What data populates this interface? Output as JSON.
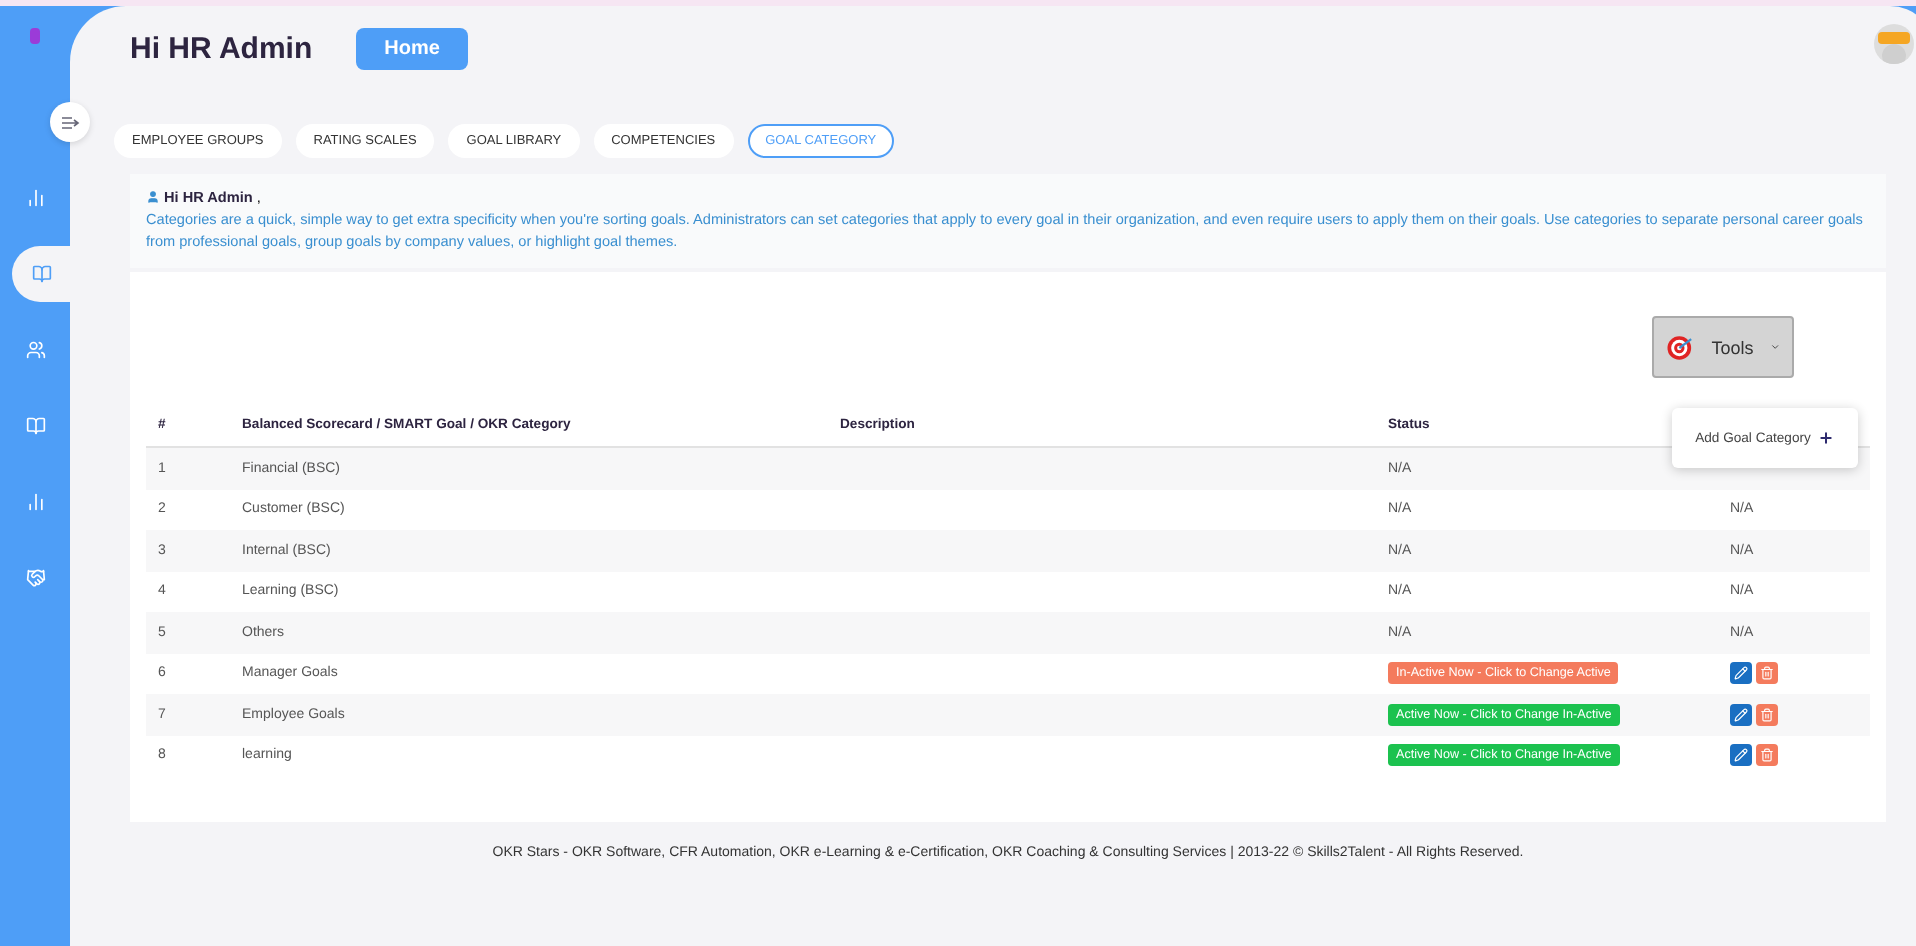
{
  "header": {
    "greeting": "Hi HR Admin",
    "home_button": "Home"
  },
  "sidebar": {
    "items": [
      {
        "selected": false
      },
      {
        "selected": true
      },
      {
        "selected": false
      },
      {
        "selected": false
      },
      {
        "selected": false
      },
      {
        "selected": false
      }
    ]
  },
  "tabs": [
    {
      "label": "EMPLOYEE GROUPS",
      "selected": false
    },
    {
      "label": "RATING SCALES",
      "selected": false
    },
    {
      "label": "GOAL LIBRARY",
      "selected": false
    },
    {
      "label": "COMPETENCIES",
      "selected": false
    },
    {
      "label": "GOAL CATEGORY",
      "selected": true
    }
  ],
  "info": {
    "greeting": "Hi HR Admin",
    "greeting_suffix": ",",
    "text": "Categories are a quick, simple way to get extra specificity when you're sorting goals. Administrators can set categories that apply to every goal in their organization, and even require users to apply them on their goals. Use categories to separate personal career goals from professional goals, group goals by company values, or highlight goal themes."
  },
  "tools": {
    "label": "Tools",
    "menu": [
      {
        "label": "Add Goal Category"
      }
    ]
  },
  "table": {
    "columns": [
      "#",
      "Balanced Scorecard / SMART Goal / OKR Category",
      "Description",
      "Status"
    ],
    "rows": [
      {
        "num": "1",
        "category": "Financial (BSC)",
        "status": {
          "kind": "text",
          "label": "N/A"
        }
      },
      {
        "num": "2",
        "category": "Customer (BSC)",
        "status": {
          "kind": "text",
          "label": "N/A"
        },
        "actions": {
          "kind": "text",
          "label": "N/A"
        }
      },
      {
        "num": "3",
        "category": "Internal (BSC)",
        "status": {
          "kind": "text",
          "label": "N/A"
        },
        "actions": {
          "kind": "text",
          "label": "N/A"
        }
      },
      {
        "num": "4",
        "category": "Learning (BSC)",
        "status": {
          "kind": "text",
          "label": "N/A"
        },
        "actions": {
          "kind": "text",
          "label": "N/A"
        }
      },
      {
        "num": "5",
        "category": "Others",
        "status": {
          "kind": "text",
          "label": "N/A"
        },
        "actions": {
          "kind": "text",
          "label": "N/A"
        }
      },
      {
        "num": "6",
        "category": "Manager Goals",
        "status": {
          "kind": "inactive",
          "label": "In-Active Now - Click to Change Active"
        },
        "actions": {
          "kind": "buttons"
        }
      },
      {
        "num": "7",
        "category": "Employee Goals",
        "status": {
          "kind": "active",
          "label": "Active Now - Click to Change In-Active"
        },
        "actions": {
          "kind": "buttons"
        }
      },
      {
        "num": "8",
        "category": "learning",
        "status": {
          "kind": "active",
          "label": "Active Now - Click to Change In-Active"
        },
        "actions": {
          "kind": "buttons"
        }
      }
    ]
  },
  "footer": "OKR Stars - OKR Software, CFR Automation, OKR e-Learning & e-Certification, OKR Coaching & Consulting Services | 2013-22 © Skills2Talent - All Rights Reserved."
}
